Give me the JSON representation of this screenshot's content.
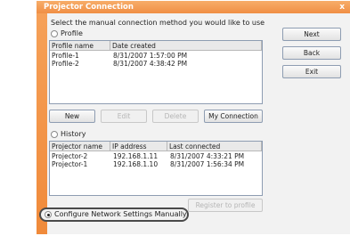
{
  "window": {
    "title": "Projector Connection",
    "close_label": "x"
  },
  "prompt": "Select the manual connection method you would like to use",
  "profile_section": {
    "label": "Profile",
    "columns": [
      "Profile name",
      "Date created"
    ],
    "rows": [
      [
        "Profile-1",
        "8/31/2007 1:57:00 PM"
      ],
      [
        "Profile-2",
        "8/31/2007 4:38:42 PM"
      ]
    ],
    "buttons": {
      "new": "New",
      "edit": "Edit",
      "delete": "Delete",
      "my_connection": "My Connection"
    }
  },
  "history_section": {
    "label": "History",
    "columns": [
      "Projector name",
      "IP address",
      "Last connected"
    ],
    "rows": [
      [
        "Projector-2",
        "192.168.1.11",
        "8/31/2007 4:33:21 PM"
      ],
      [
        "Projector-1",
        "192.168.1.10",
        "8/31/2007 1:56:34 PM"
      ]
    ],
    "register_button": "Register to profile"
  },
  "configure_option": {
    "label": "Configure Network Settings Manually",
    "selected": true
  },
  "side_buttons": {
    "next": "Next",
    "back": "Back",
    "exit": "Exit"
  }
}
